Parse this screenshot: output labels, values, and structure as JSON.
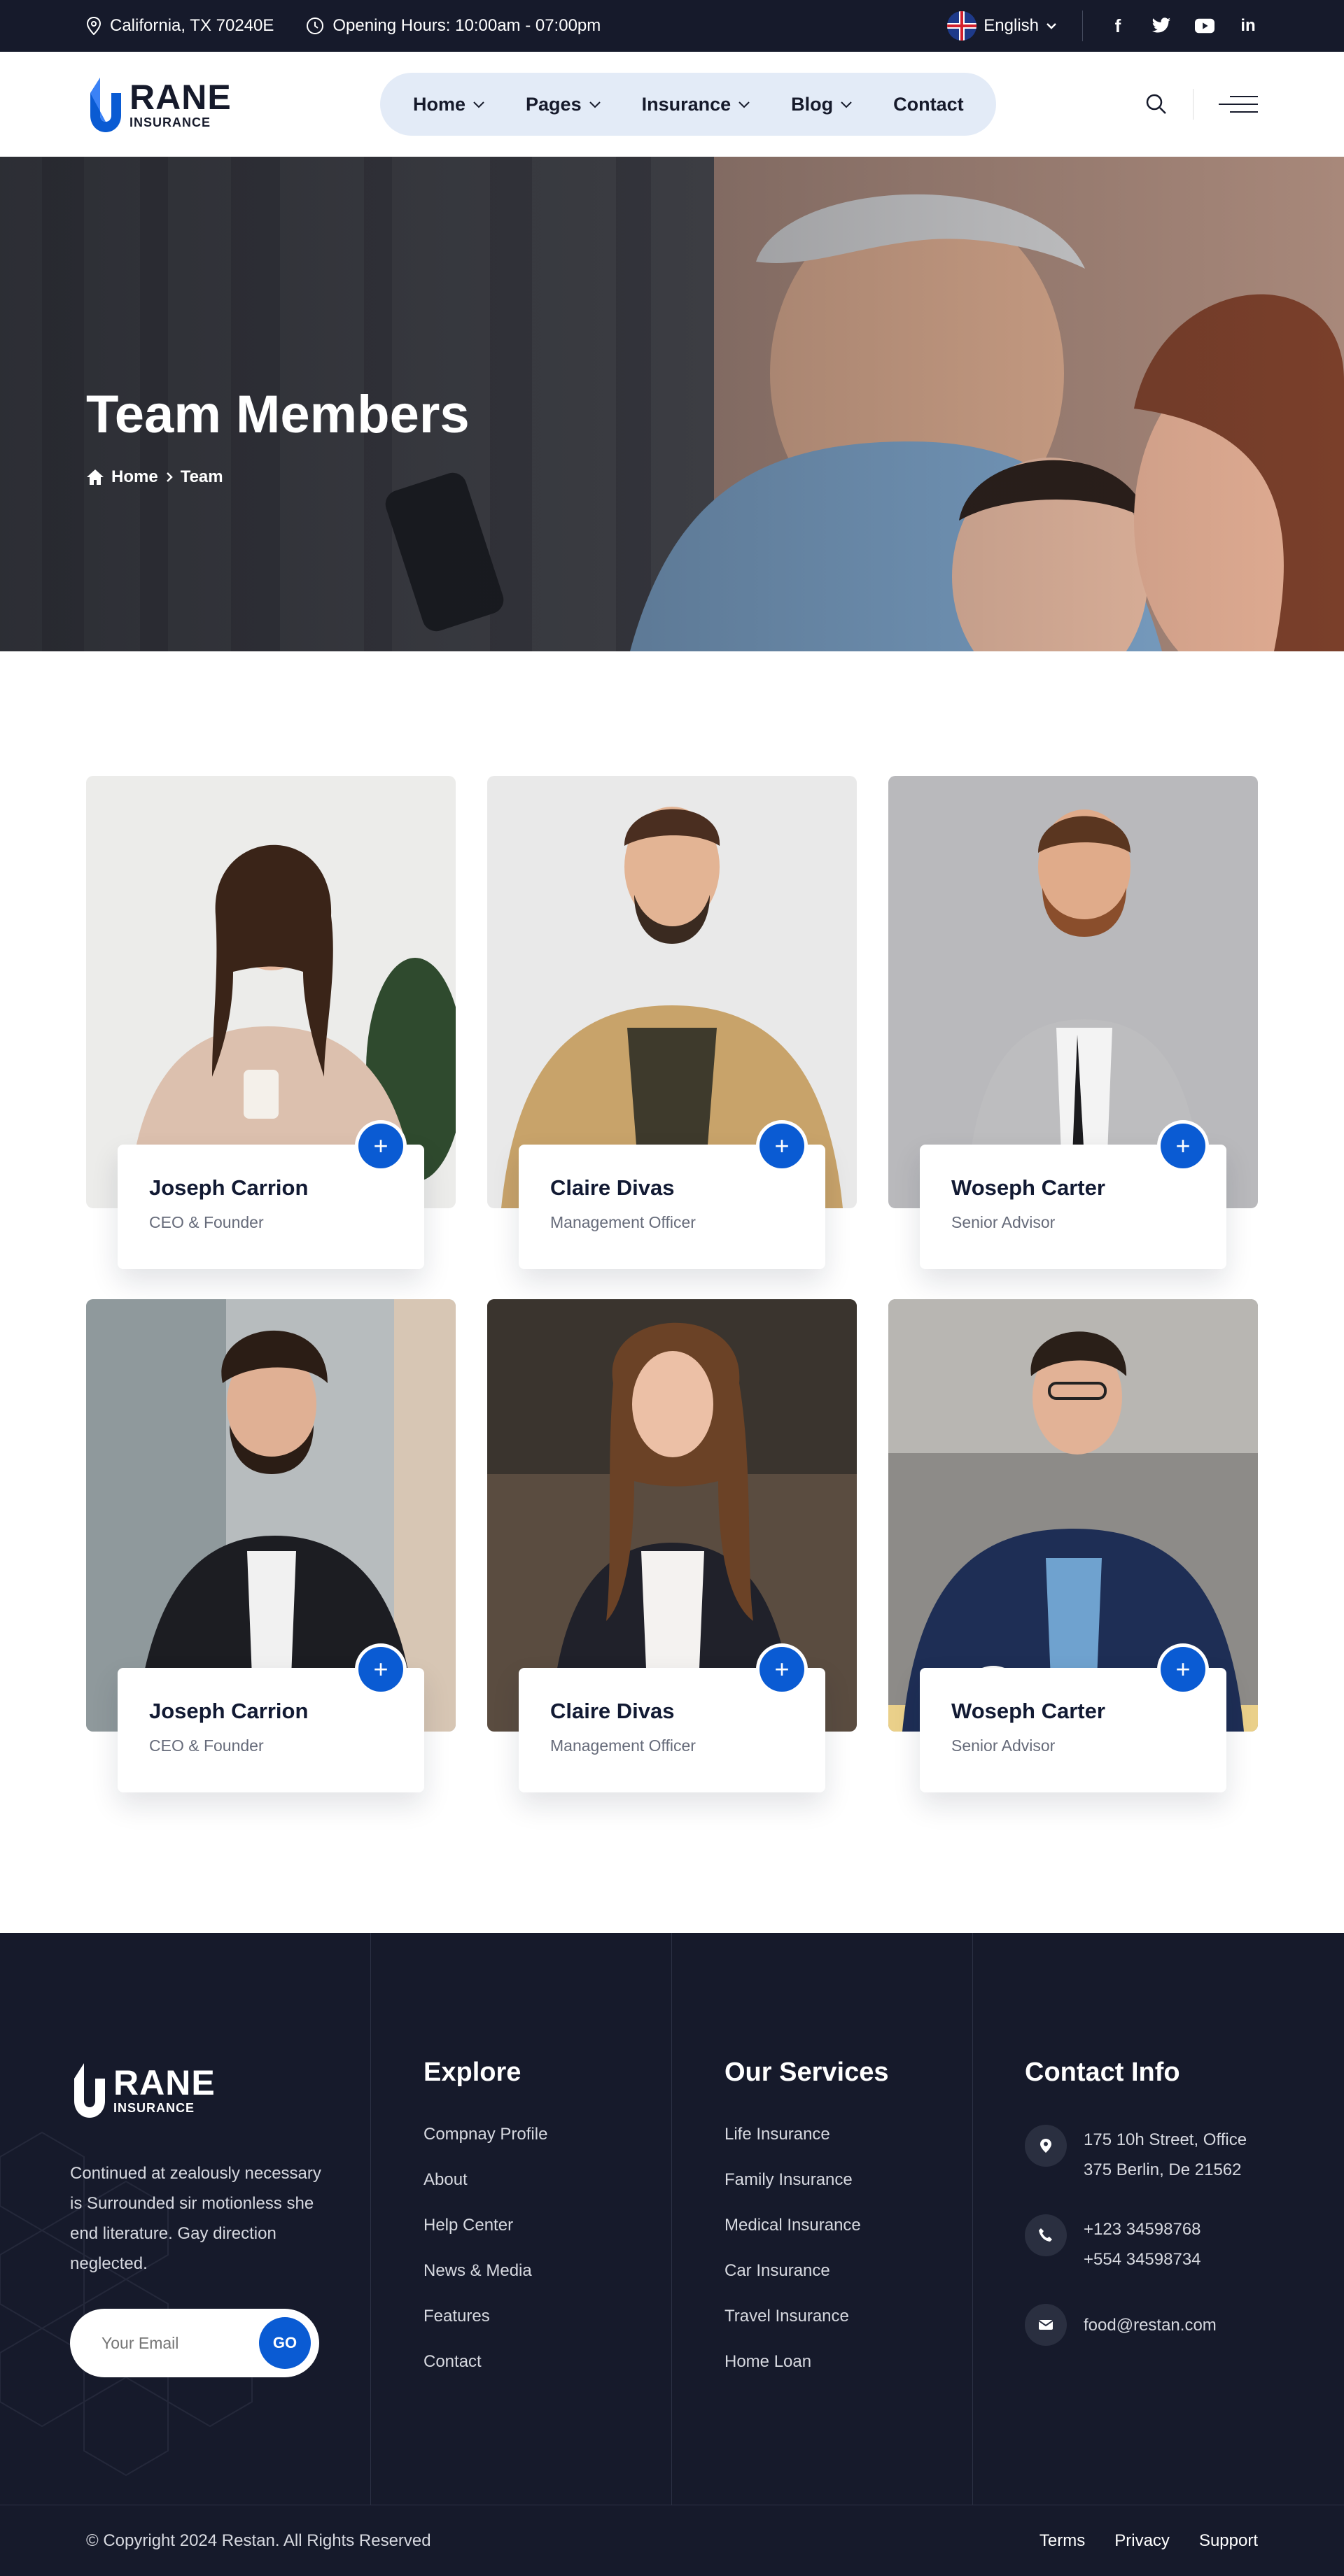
{
  "topbar": {
    "location": "California, TX 70240E",
    "hours": "Opening Hours: 10:00am - 07:00pm",
    "language": "English",
    "socials": [
      "facebook-icon",
      "twitter-icon",
      "youtube-icon",
      "linkedin-icon"
    ]
  },
  "brand": {
    "name": "RANE",
    "tagline": "INSURANCE",
    "accent": "#0a5bd3"
  },
  "nav": {
    "home": "Home",
    "pages": "Pages",
    "insurance": "Insurance",
    "blog": "Blog",
    "contact": "Contact"
  },
  "hero": {
    "title": "Team Members",
    "breadcrumb": {
      "home": "Home",
      "current": "Team"
    }
  },
  "team": [
    {
      "name": "Joseph Carrion",
      "role": "CEO & Founder"
    },
    {
      "name": "Claire Divas",
      "role": "Management Officer"
    },
    {
      "name": "Woseph Carter",
      "role": "Senior Advisor"
    },
    {
      "name": "Joseph Carrion",
      "role": "CEO & Founder"
    },
    {
      "name": "Claire Divas",
      "role": "Management Officer"
    },
    {
      "name": "Woseph Carter",
      "role": "Senior Advisor"
    }
  ],
  "footer": {
    "description": "Continued at zealously necessary is Surrounded sir motionless she end literature. Gay direction neglected.",
    "email_placeholder": "Your Email",
    "go_label": "GO",
    "explore": {
      "title": "Explore",
      "links": [
        "Compnay Profile",
        "About",
        "Help Center",
        "News & Media",
        "Features",
        "Contact"
      ]
    },
    "services": {
      "title": "Our Services",
      "links": [
        "Life Insurance",
        "Family Insurance",
        "Medical Insurance",
        "Car Insurance",
        "Travel Insurance",
        "Home Loan"
      ]
    },
    "contact": {
      "title": "Contact Info",
      "address_1": "175 10h Street, Office",
      "address_2": "375 Berlin, De 21562",
      "phone_1": "+123 34598768",
      "phone_2": "+554 34598734",
      "email": "food@restan.com"
    },
    "copyright": "© Copyright 2024 Restan. All Rights Reserved",
    "bottom_links": [
      "Terms",
      "Privacy",
      "Support"
    ]
  }
}
